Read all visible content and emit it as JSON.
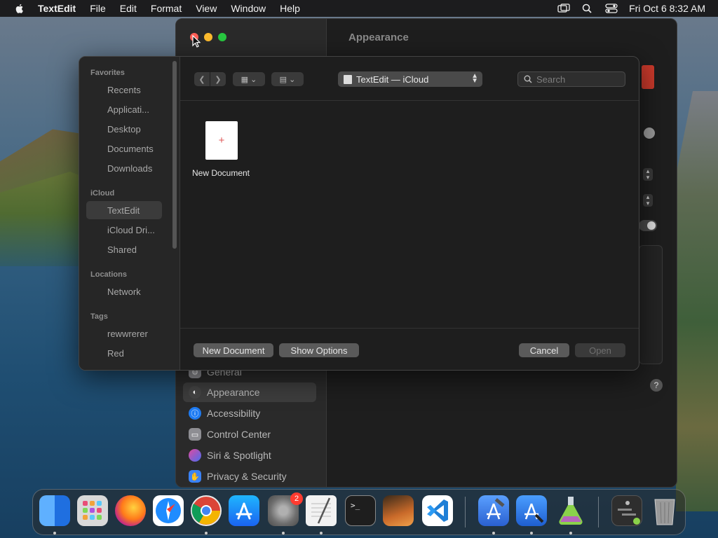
{
  "menubar": {
    "app_name": "TextEdit",
    "items": [
      "File",
      "Edit",
      "Format",
      "View",
      "Window",
      "Help"
    ],
    "datetime": "Fri Oct 6  8:32 AM"
  },
  "settings_window": {
    "title": "Appearance",
    "sidebar_items": [
      {
        "label": "General",
        "icon": "gear-icon",
        "color": "#8e8e93"
      },
      {
        "label": "Appearance",
        "icon": "appearance-icon",
        "color": "#444444",
        "active": true
      },
      {
        "label": "Accessibility",
        "icon": "accessibility-icon",
        "color": "#1e7bf2"
      },
      {
        "label": "Control Center",
        "icon": "control-center-icon",
        "color": "#8e8e93"
      },
      {
        "label": "Siri & Spotlight",
        "icon": "siri-icon",
        "color": "#b44ac8"
      },
      {
        "label": "Privacy & Security",
        "icon": "hand-icon",
        "color": "#3a82f6"
      }
    ]
  },
  "open_panel": {
    "sidebar": {
      "sections": [
        {
          "title": "Favorites",
          "items": [
            "Recents",
            "Applicati...",
            "Desktop",
            "Documents",
            "Downloads"
          ]
        },
        {
          "title": "iCloud",
          "items": [
            "TextEdit",
            "iCloud Dri...",
            "Shared"
          ]
        },
        {
          "title": "Locations",
          "items": [
            "Network"
          ]
        },
        {
          "title": "Tags",
          "items": [
            "rewwrerer",
            "Red"
          ]
        }
      ],
      "selected": "TextEdit"
    },
    "location": "TextEdit — iCloud",
    "search_placeholder": "Search",
    "files": [
      {
        "label": "New Document"
      }
    ],
    "buttons": {
      "new_document": "New Document",
      "show_options": "Show Options",
      "cancel": "Cancel",
      "open": "Open"
    }
  },
  "dock": {
    "apps": [
      {
        "name": "finder-icon",
        "color": "#1e8ef5",
        "running": true
      },
      {
        "name": "launchpad-icon",
        "color": "#d9d9d9",
        "running": false
      },
      {
        "name": "firefox-icon",
        "color": "#ff7a1a",
        "running": false
      },
      {
        "name": "safari-icon",
        "color": "#1f8cff",
        "running": false
      },
      {
        "name": "chrome-icon",
        "color": "#e9e9e9",
        "running": true
      },
      {
        "name": "app-store-icon",
        "color": "#1a8cff",
        "running": false
      },
      {
        "name": "system-settings-icon",
        "color": "#8a8a8a",
        "running": true,
        "badge": "2"
      },
      {
        "name": "textedit-icon",
        "color": "#f2f2f2",
        "running": true
      },
      {
        "name": "terminal-icon",
        "color": "#1e1e1e",
        "running": false
      },
      {
        "name": "garageband-icon",
        "color": "#c96a2a",
        "running": false
      },
      {
        "name": "vscode-icon",
        "color": "#1f7fd6",
        "running": false
      },
      {
        "name": "xcode-icon",
        "color": "#3a7bd5",
        "running": true
      },
      {
        "name": "instruments-icon",
        "color": "#2a7fe0",
        "running": true
      },
      {
        "name": "create-ml-icon",
        "color": "#8ad24a",
        "running": true
      },
      {
        "name": "downloads-stack-icon",
        "color": "#3a3a3a",
        "running": false
      },
      {
        "name": "trash-icon",
        "color": "#9a9a9a",
        "running": false
      }
    ]
  }
}
